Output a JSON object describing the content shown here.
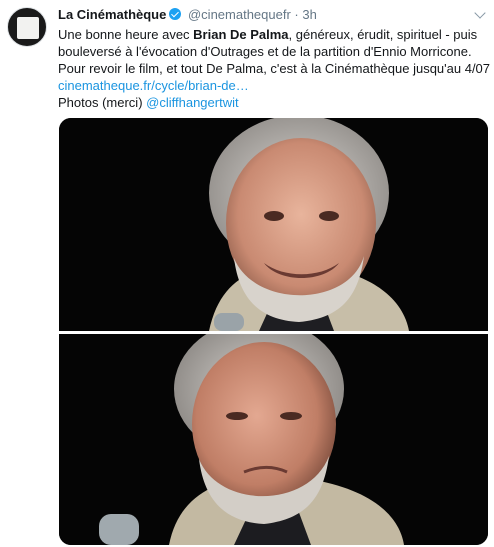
{
  "tweet": {
    "author_name": "La Cinémathèque",
    "handle": "@cinemathequefr",
    "separator": "·",
    "time": "3h",
    "text": {
      "line1_prefix": "Une bonne heure avec ",
      "line1_bold": "Brian De Palma",
      "line1_suffix": ", généreux, érudit, spirituel - puis",
      "line2": "bouleversé à l'évocation d'Outrages et de la partition d'Ennio Morricone.",
      "line3": "Pour revoir le film, et tout De Palma, c'est à la Cinémathèque jusqu'au 4/07",
      "link": "cinematheque.fr/cycle/brian-de…",
      "photos_prefix": "Photos (merci) ",
      "photos_mention": "@cliffhangertwit"
    }
  },
  "icons": {
    "avatar": "cinematheque-logo",
    "verified": "verified-badge-icon",
    "more": "chevron-down-icon"
  },
  "colors": {
    "link": "#1b95e0",
    "verified": "#1da1f2",
    "muted": "#657786"
  }
}
